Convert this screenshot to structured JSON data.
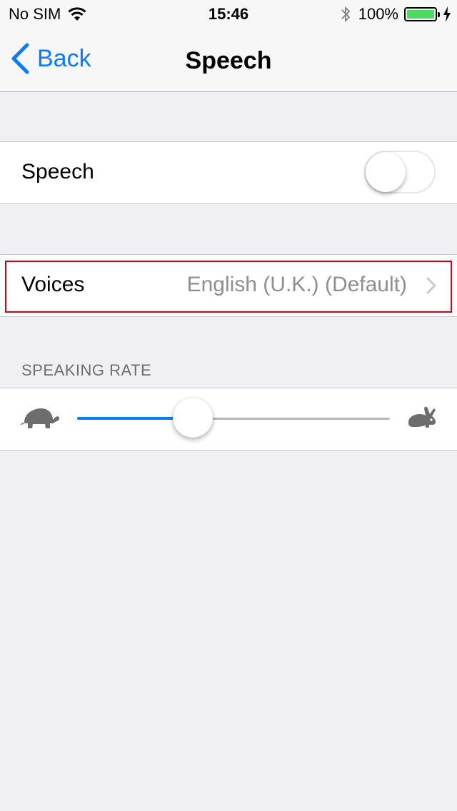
{
  "status_bar": {
    "carrier": "No SIM",
    "time": "15:46",
    "battery": "100%",
    "battery_level": 1.0,
    "battery_color": "#4cd964"
  },
  "nav": {
    "back_label": "Back",
    "title": "Speech"
  },
  "speech_row": {
    "label": "Speech",
    "toggle_on": false
  },
  "voices_row": {
    "label": "Voices",
    "value": "English (U.K.) (Default)"
  },
  "speaking_rate": {
    "header": "SPEAKING RATE",
    "slider_value": 0.37,
    "min_icon": "turtle-icon",
    "max_icon": "hare-icon"
  },
  "colors": {
    "accent": "#0a7aff",
    "highlight": "#d0021b"
  }
}
